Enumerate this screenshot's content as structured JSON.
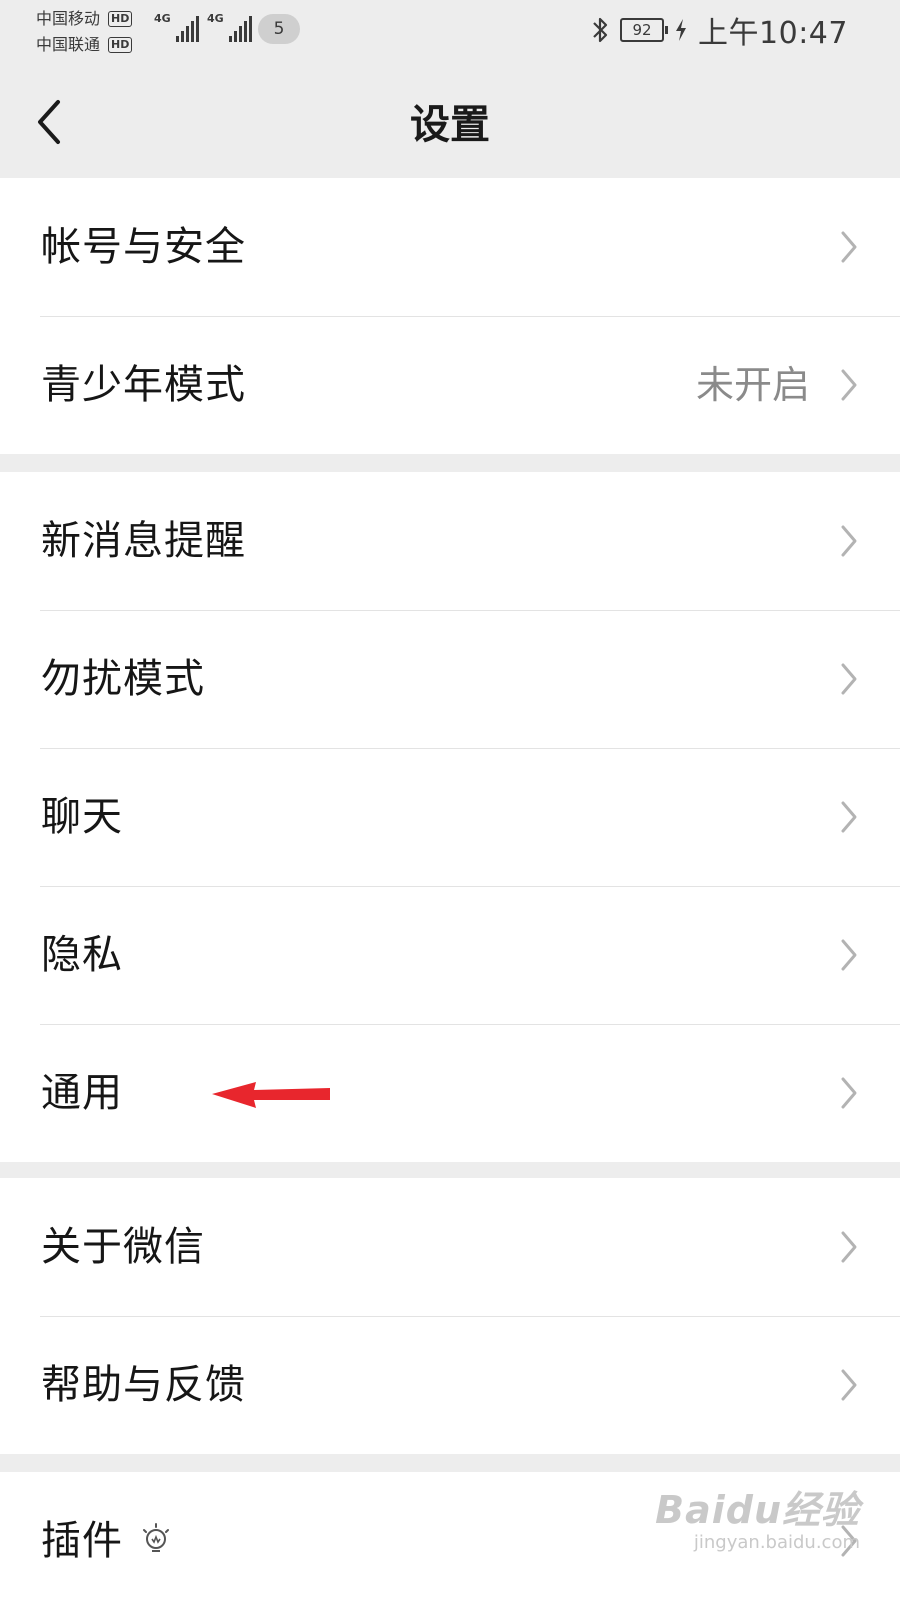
{
  "status_bar": {
    "carrier_1": "中国移动",
    "carrier_2": "中国联通",
    "hd_badge": "HD",
    "network_type": "4G",
    "notification_count": "5",
    "battery_level": "92",
    "time": "上午10:47"
  },
  "nav": {
    "title": "设置"
  },
  "groups": [
    {
      "items": [
        {
          "label": "帐号与安全"
        },
        {
          "label": "青少年模式",
          "value": "未开启"
        }
      ]
    },
    {
      "items": [
        {
          "label": "新消息提醒"
        },
        {
          "label": "勿扰模式"
        },
        {
          "label": "聊天"
        },
        {
          "label": "隐私"
        },
        {
          "label": "通用"
        }
      ]
    },
    {
      "items": [
        {
          "label": "关于微信"
        },
        {
          "label": "帮助与反馈"
        }
      ]
    },
    {
      "items": [
        {
          "label": "插件"
        }
      ]
    }
  ],
  "watermark": {
    "logo": "Baidu经验",
    "url": "jingyan.baidu.com"
  },
  "colors": {
    "background": "#ededed",
    "card": "#ffffff",
    "annotation_arrow": "#e8262d"
  }
}
